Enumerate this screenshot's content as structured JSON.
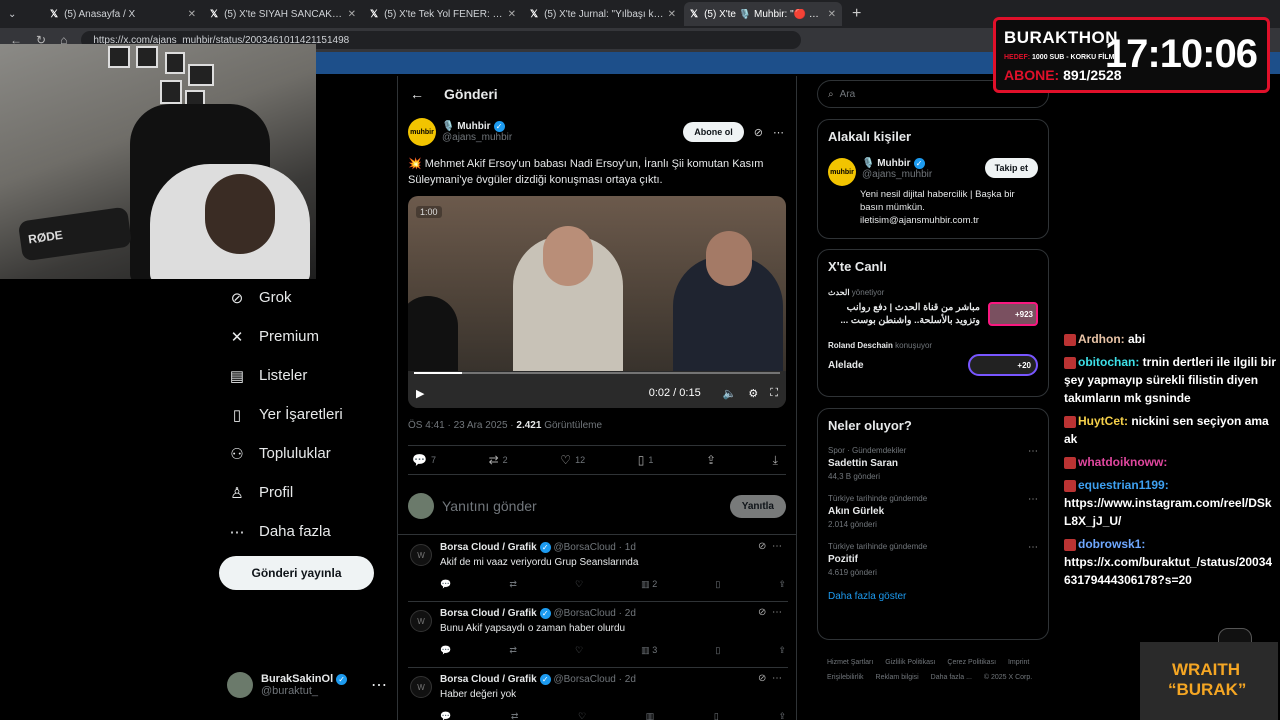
{
  "browser": {
    "tabs": [
      {
        "title": "(5) Anasayfa / X",
        "active": false
      },
      {
        "title": "(5) X'te SİYAH SANCAK: \"🔵 Sade",
        "active": false
      },
      {
        "title": "(5) X'te Tek Yol FENER: \"Fenerbahçe",
        "active": false
      },
      {
        "title": "(5) X'te Jurnal: \"Yılbaşı kutlamayan",
        "active": false
      },
      {
        "title": "(5) X'te 🎙️ Muhbir: \"🔴 Mehmet A",
        "active": true
      }
    ],
    "url": "https://x.com/ajans_muhbir/status/2003461011421151498"
  },
  "left_nav": {
    "items": [
      {
        "icon": "grok-icon",
        "glyph": "⊘",
        "label": "Grok"
      },
      {
        "icon": "premium-icon",
        "glyph": "✕",
        "label": "Premium"
      },
      {
        "icon": "lists-icon",
        "glyph": "▤",
        "label": "Listeler"
      },
      {
        "icon": "bookmark-icon",
        "glyph": "▯",
        "label": "Yer İşaretleri"
      },
      {
        "icon": "communities-icon",
        "glyph": "⚇",
        "label": "Topluluklar"
      },
      {
        "icon": "profile-icon",
        "glyph": "♙",
        "label": "Profil"
      },
      {
        "icon": "more-icon",
        "glyph": "⋯",
        "label": "Daha fazla"
      }
    ],
    "post_button": "Gönderi yayınla",
    "account": {
      "name": "BurakSakinOl",
      "handle": "@buraktut_"
    }
  },
  "main": {
    "header": "Gönderi",
    "post": {
      "author_name": "🎙️ Muhbir",
      "author_handle": "@ajans_muhbir",
      "logo_text": "muhbir",
      "subscribe": "Abone ol",
      "text": "💥 Mehmet Akif Ersoy'un babası Nadi Ersoy'un, İranlı Şii komutan Kasım Süleymani'ye övgüler dizdiği konuşması ortaya çıktı.",
      "video": {
        "badge": "1:00",
        "time": "0:02 / 0:15",
        "progress": 0.13
      },
      "date": "ÖS 4:41 · 23 Ara 2025 · ",
      "views_count": "2.421",
      "views_label": " Görüntüleme",
      "actions": {
        "replies": "7",
        "reposts": "2",
        "likes": "12",
        "bookmarks": "1"
      }
    },
    "reply_placeholder": "Yanıtını gönder",
    "reply_button": "Yanıtla",
    "replies": [
      {
        "name": "Borsa Cloud / Grafik",
        "handle": "@BorsaCloud",
        "time": "· 1d",
        "text": "Akif de mi vaaz veriyordu Grup Seanslarında",
        "views": "2"
      },
      {
        "name": "Borsa Cloud / Grafik",
        "handle": "@BorsaCloud",
        "time": "· 2d",
        "text": "Bunu Akif yapsaydı o zaman haber olurdu",
        "views": "3"
      },
      {
        "name": "Borsa Cloud / Grafik",
        "handle": "@BorsaCloud",
        "time": "· 2d",
        "text": "Haber değeri yok",
        "views": ""
      }
    ]
  },
  "right": {
    "search_placeholder": "Ara",
    "related": {
      "title": "Alakalı kişiler",
      "name": "🎙️ Muhbir",
      "handle": "@ajans_muhbir",
      "follow": "Takip et",
      "bio": "Yeni nesil dijital habercilik | Başka bir basın mümkün. iletisim@ajansmuhbir.com.tr"
    },
    "live": {
      "title": "X'te Canlı",
      "item1_source": "الحدث",
      "item1_role": "yönetiyor",
      "item1_title": "مباشر من قناة الحدث | دفع روانب وتزويد بالأسلحة.. واشنطن بوست ...",
      "item1_count": "+923",
      "item2_source": "Roland Deschain",
      "item2_role": "konuşuyor",
      "item2_title": "Alelade",
      "item2_count": "+20"
    },
    "trends": {
      "title": "Neler oluyor?",
      "items": [
        {
          "meta": "Spor · Gündemdekiler",
          "name": "Sadettin Saran",
          "count": "44,3 B gönderi"
        },
        {
          "meta": "Türkiye tarihinde gündemde",
          "name": "Akın Gürlek",
          "count": "2.014 gönderi"
        },
        {
          "meta": "Türkiye tarihinde gündemde",
          "name": "Pozitif",
          "count": "4.619 gönderi"
        }
      ],
      "show_more": "Daha fazla göster"
    },
    "footer": [
      "Hizmet Şartları",
      "Gizlilik Politikası",
      "Çerez Politikası",
      "Imprint",
      "Erişilebilirlik",
      "Reklam bilgisi",
      "Daha fazla ...",
      "© 2025 X Corp."
    ]
  },
  "overlay": {
    "timer_brand": "BURAKTHON",
    "goal_label": "HEDEF:",
    "goal_value": "1000 SUB - KORKU FİLMİ",
    "sub_label": "ABONE:",
    "sub_value": "891/2528",
    "clock": "17:10:06",
    "chat": [
      {
        "user": "Ardhon:",
        "text": " abi",
        "color": "#e9c4a7"
      },
      {
        "user": "obitochan:",
        "text": " trnin dertleri ile ilgili bir şey yapmayıp sürekli filistin diyen takımların mk gsninde",
        "color": "#3ee0e8"
      },
      {
        "user": "HuytCet:",
        "text": " nickini sen seçiyon ama ak",
        "color": "#f5d04a"
      },
      {
        "user": "whatdoiknoww:",
        "text": "",
        "color": "#e0479e"
      },
      {
        "user": "equestrian1199:",
        "text": " https://www.instagram.com/reel/DSkL8X_jJ_U/",
        "color": "#3ea0f0"
      },
      {
        "user": "dobrowsk1:",
        "text": " https://x.com/buraktut_/status/2003463179444306178?s=20",
        "color": "#6fa8ff"
      }
    ],
    "sponsor_line1": "WRAITH",
    "sponsor_line2": "“BURAK”"
  }
}
